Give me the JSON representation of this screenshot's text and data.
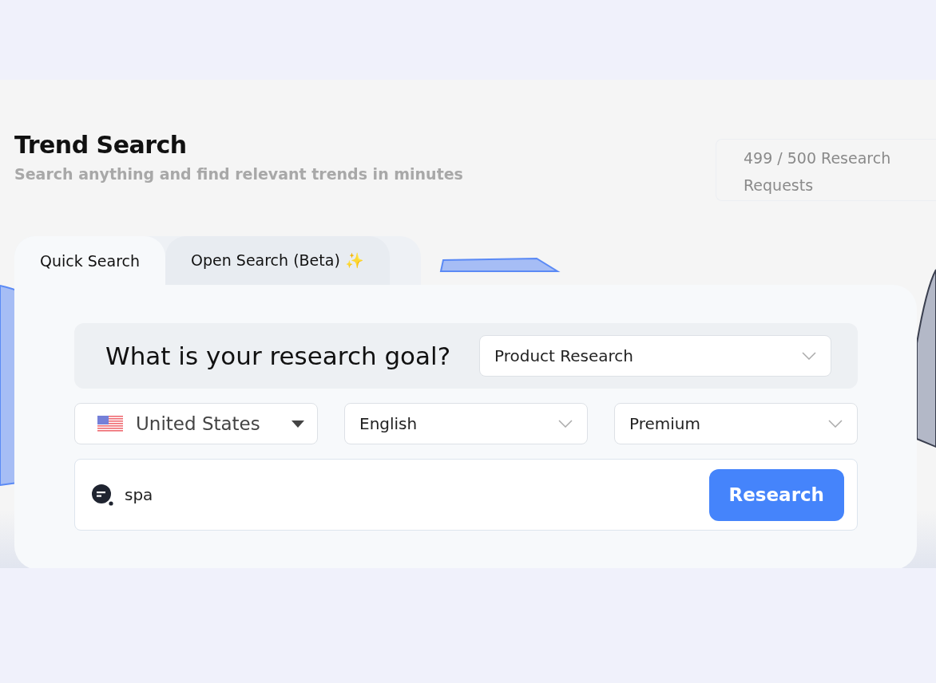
{
  "header": {
    "title": "Trend Search",
    "subtitle": "Search anything and find relevant trends in minutes"
  },
  "usage": {
    "text": "499 / 500 Research Requests"
  },
  "tabs": [
    {
      "label": "Quick Search",
      "selected": true
    },
    {
      "label": "Open Search (Beta) ✨",
      "selected": false
    }
  ],
  "goal": {
    "question": "What is your research goal?",
    "value": "Product Research"
  },
  "filters": [
    {
      "kind": "country",
      "value": "United States"
    },
    {
      "kind": "select",
      "value": "English"
    },
    {
      "kind": "select",
      "value": "Premium"
    }
  ],
  "search": {
    "value": "spa",
    "button": "Research"
  }
}
